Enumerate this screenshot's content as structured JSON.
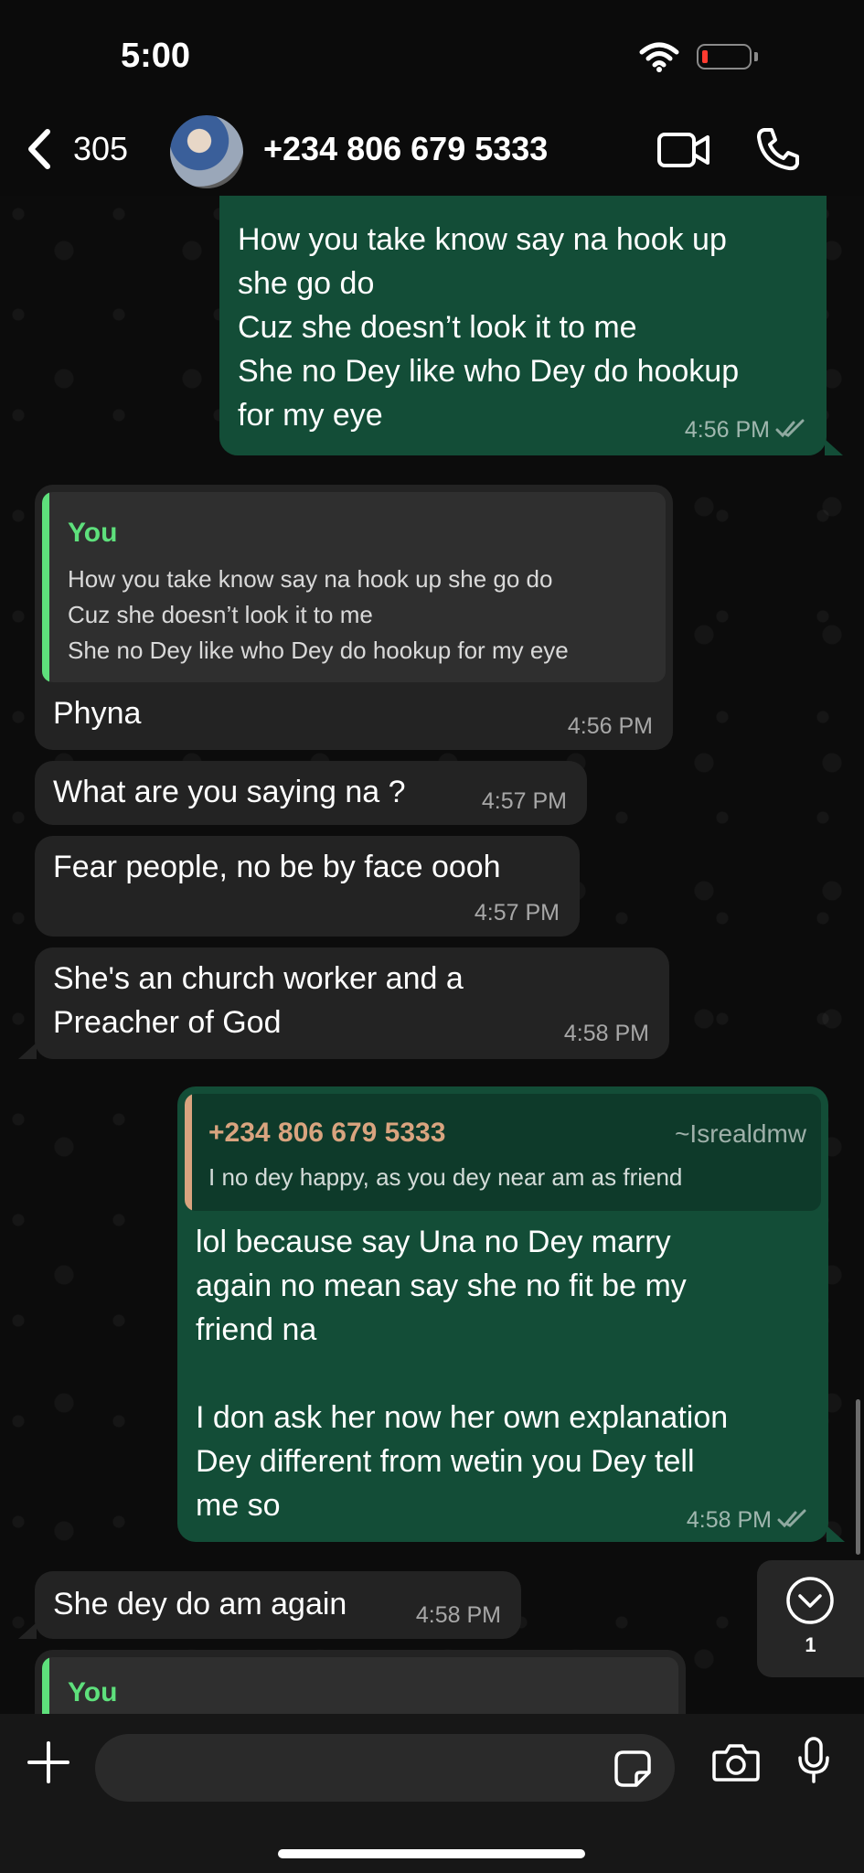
{
  "status": {
    "time": "5:00"
  },
  "header": {
    "back_count": "305",
    "contact": "+234 806 679 5333"
  },
  "messages": [
    {
      "side": "out",
      "text": "How you take know say na hook up\nshe go do\nCuz she doesn’t look it to me\nShe no Dey like who Dey do hookup\nfor my eye",
      "time": "4:56 PM"
    },
    {
      "side": "in",
      "quote_author": "You",
      "quote_text": "How you take know say na hook up she go do\nCuz she doesn’t look it to me\nShe no Dey like who Dey do hookup for my eye",
      "text": "Phyna",
      "time": "4:56 PM"
    },
    {
      "side": "in",
      "text": "What are you saying na ?",
      "time": "4:57 PM"
    },
    {
      "side": "in",
      "text": "Fear people, no be by face oooh",
      "time": "4:57 PM"
    },
    {
      "side": "in",
      "text": "She's an church worker and a\nPreacher of God",
      "time": "4:58 PM"
    },
    {
      "side": "out",
      "quote_author": "+234 806 679 5333",
      "quote_sub": "~Isrealdmw",
      "quote_text": "I no dey happy, as you dey near am as friend",
      "text": "lol because say Una no Dey marry\nagain no mean say she no fit be my\nfriend na\n\nI don ask her now her own explanation\nDey different from wetin you Dey tell\nme so",
      "time": "4:58 PM"
    },
    {
      "side": "in",
      "text": "She dey do am again",
      "time": "4:58 PM"
    },
    {
      "side": "in",
      "quote_author": "You"
    }
  ],
  "scroll_button": {
    "unread": "1"
  },
  "colors": {
    "incoming": "#232323",
    "outgoing": "#134d37",
    "quote_you": "#5ee07c",
    "quote_contact": "#d9a47f",
    "ticks": "#8fa9a0"
  }
}
